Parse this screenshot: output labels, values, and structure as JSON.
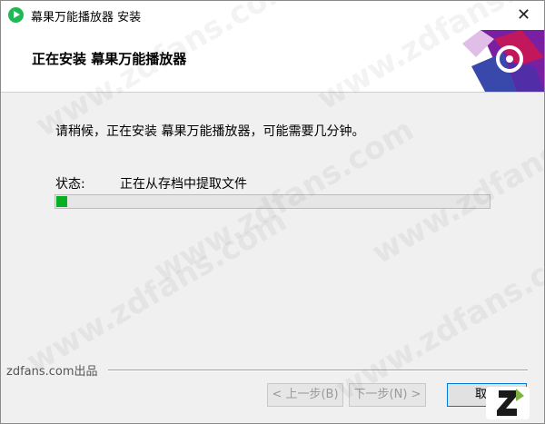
{
  "window": {
    "title": "幕果万能播放器 安装",
    "close_label": "✕"
  },
  "header": {
    "title": "正在安装 幕果万能播放器"
  },
  "main": {
    "message": "请稍候，正在安装 幕果万能播放器，可能需要几分钟。",
    "status_label": "状态:",
    "status_value": "正在从存档中提取文件",
    "progress_percent": 2.5
  },
  "footer": {
    "brand": "zdfans.com出品",
    "back_label": "< 上一步(B)",
    "next_label": "下一步(N) >",
    "cancel_label": "取消"
  },
  "watermark_text": "www.zdfans.com",
  "colors": {
    "accent": "#06b025",
    "focus": "#0078d7",
    "app_icon": "#1fb855",
    "header_art": "#7b1fa2"
  }
}
